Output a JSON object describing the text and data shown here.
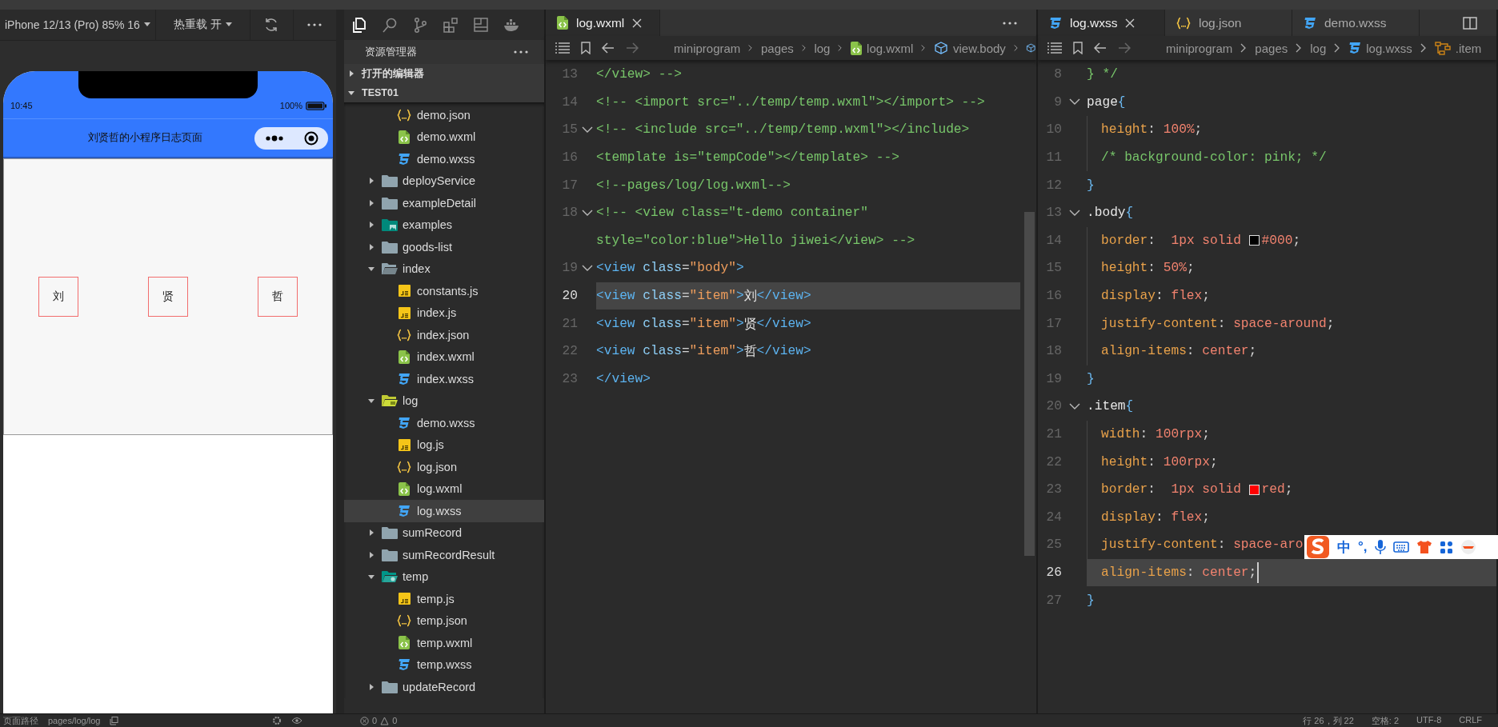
{
  "simulator": {
    "device": "iPhone 12/13 (Pro) 85% 16",
    "hot_reload": "热重载 开",
    "time": "10:45",
    "battery": "100%",
    "nav_title": "刘贤哲的小程序日志页面",
    "items": [
      "刘",
      "贤",
      "哲"
    ]
  },
  "activity_bar": [
    {
      "kind": "files",
      "selected": true
    },
    {
      "kind": "search",
      "selected": false
    },
    {
      "kind": "branch",
      "selected": false
    },
    {
      "kind": "extensions",
      "selected": false
    },
    {
      "kind": "layout",
      "selected": false
    },
    {
      "kind": "whale",
      "selected": false
    }
  ],
  "explorer": {
    "title": "资源管理器",
    "sections": [
      {
        "label": "打开的编辑器",
        "expanded": false
      },
      {
        "label": "TEST01",
        "expanded": true
      }
    ],
    "tree": [
      {
        "children": [
          {
            "label": "demo.json",
            "kind": "json",
            "selected": false
          },
          {
            "label": "demo.wxml",
            "kind": "wxml",
            "selected": false
          },
          {
            "label": "demo.wxss",
            "kind": "wxss",
            "selected": false
          }
        ]
      },
      {
        "label": "deployService",
        "kind": "folder",
        "expanded": false
      },
      {
        "label": "exampleDetail",
        "kind": "folder",
        "expanded": false
      },
      {
        "label": "examples",
        "kind": "folder-images",
        "expanded": false
      },
      {
        "label": "goods-list",
        "kind": "folder",
        "expanded": false
      },
      {
        "label": "index",
        "kind": "folder",
        "expanded": true,
        "children": [
          {
            "label": "constants.js",
            "kind": "js",
            "selected": false
          },
          {
            "label": "index.js",
            "kind": "js",
            "selected": false
          },
          {
            "label": "index.json",
            "kind": "json",
            "selected": false
          },
          {
            "label": "index.wxml",
            "kind": "wxml",
            "selected": false
          },
          {
            "label": "index.wxss",
            "kind": "wxss",
            "selected": false
          }
        ]
      },
      {
        "label": "log",
        "kind": "folder-log",
        "expanded": true,
        "children": [
          {
            "label": "demo.wxss",
            "kind": "wxss",
            "selected": false
          },
          {
            "label": "log.js",
            "kind": "js",
            "selected": false
          },
          {
            "label": "log.json",
            "kind": "json",
            "selected": false
          },
          {
            "label": "log.wxml",
            "kind": "wxml",
            "selected": false
          },
          {
            "label": "log.wxss",
            "kind": "wxss",
            "selected": true
          }
        ]
      },
      {
        "label": "sumRecord",
        "kind": "folder",
        "expanded": false
      },
      {
        "label": "sumRecordResult",
        "kind": "folder",
        "expanded": false
      },
      {
        "label": "temp",
        "kind": "folder-temp",
        "expanded": true,
        "children": [
          {
            "label": "temp.js",
            "kind": "js",
            "selected": false
          },
          {
            "label": "temp.json",
            "kind": "json",
            "selected": false
          },
          {
            "label": "temp.wxml",
            "kind": "wxml",
            "selected": false
          },
          {
            "label": "temp.wxss",
            "kind": "wxss",
            "selected": false
          }
        ]
      },
      {
        "label": "updateRecord",
        "kind": "folder",
        "expanded": false
      }
    ]
  },
  "editors": [
    {
      "tabs": [
        {
          "label": "log.wxml",
          "kind": "wxml",
          "selected": true
        }
      ],
      "breadcrumb": [
        {
          "label": "miniprogram",
          "kind": "folder"
        },
        {
          "label": "pages",
          "kind": "folder"
        },
        {
          "label": "log",
          "kind": "folder"
        },
        {
          "label": "log.wxml",
          "kind": "wxml"
        },
        {
          "label": "view.body",
          "kind": "node"
        },
        {
          "kind": "node"
        }
      ],
      "lines": [
        {
          "number": "13",
          "foldable": false,
          "current": false,
          "indented": false,
          "segments": [
            {
              "text": "</view> -->",
              "kind": "comment"
            }
          ]
        },
        {
          "number": "14",
          "foldable": false,
          "current": false,
          "indented": false,
          "segments": [
            {
              "text": "<!-- <import src=\"../temp/temp.wxml\"></import> -->",
              "kind": "comment"
            }
          ]
        },
        {
          "number": "15",
          "foldable": true,
          "current": false,
          "indented": false,
          "segments": [
            {
              "text": "<!-- <include src=\"../temp/temp.wxml\"></include>",
              "kind": "comment"
            }
          ]
        },
        {
          "number": "16",
          "foldable": false,
          "current": false,
          "indented": false,
          "segments": [
            {
              "text": "<template is=\"tempCode\"></template> -->",
              "kind": "comment"
            }
          ]
        },
        {
          "number": "17",
          "foldable": false,
          "current": false,
          "indented": false,
          "segments": [
            {
              "text": "<!--pages/log/log.wxml-->",
              "kind": "comment"
            }
          ]
        },
        {
          "number": "18",
          "foldable": true,
          "current": false,
          "indented": false,
          "segments": [
            {
              "text": "<!-- <view class=\"t-demo container\"",
              "kind": "comment"
            }
          ]
        },
        {
          "foldable": false,
          "current": false,
          "indented": false,
          "segments": [
            {
              "text": "style=\"color:blue\">Hello jiwei</view> -->",
              "kind": "comment"
            }
          ]
        },
        {
          "number": "19",
          "foldable": true,
          "current": false,
          "indented": false,
          "segments": [
            {
              "text": "<view",
              "kind": "tag"
            },
            {
              "text": " class",
              "kind": "attr"
            },
            {
              "text": "=",
              "kind": "punct"
            },
            {
              "text": "\"body\"",
              "kind": "string"
            },
            {
              "text": ">",
              "kind": "tag"
            }
          ]
        },
        {
          "number": "20",
          "foldable": false,
          "current": true,
          "indented": false,
          "segments": [
            {
              "text": "<view",
              "kind": "tag"
            },
            {
              "text": " class",
              "kind": "attr"
            },
            {
              "text": "=",
              "kind": "punct"
            },
            {
              "text": "\"item\"",
              "kind": "string"
            },
            {
              "text": ">",
              "kind": "tag"
            },
            {
              "text": "刘",
              "kind": "text"
            },
            {
              "text": "</view>",
              "kind": "tag"
            }
          ]
        },
        {
          "number": "21",
          "foldable": false,
          "current": false,
          "indented": false,
          "segments": [
            {
              "text": "<view",
              "kind": "tag"
            },
            {
              "text": " class",
              "kind": "attr"
            },
            {
              "text": "=",
              "kind": "punct"
            },
            {
              "text": "\"item\"",
              "kind": "string"
            },
            {
              "text": ">",
              "kind": "tag"
            },
            {
              "text": "贤",
              "kind": "text"
            },
            {
              "text": "</view>",
              "kind": "tag"
            }
          ]
        },
        {
          "number": "22",
          "foldable": false,
          "current": false,
          "indented": false,
          "segments": [
            {
              "text": "<view",
              "kind": "tag"
            },
            {
              "text": " class",
              "kind": "attr"
            },
            {
              "text": "=",
              "kind": "punct"
            },
            {
              "text": "\"item\"",
              "kind": "string"
            },
            {
              "text": ">",
              "kind": "tag"
            },
            {
              "text": "哲",
              "kind": "text"
            },
            {
              "text": "</view>",
              "kind": "tag"
            }
          ]
        },
        {
          "number": "23",
          "foldable": false,
          "current": false,
          "indented": false,
          "segments": [
            {
              "text": "</view>",
              "kind": "tag"
            }
          ]
        }
      ]
    },
    {
      "tabs": [
        {
          "label": "log.wxss",
          "kind": "wxss",
          "selected": true
        },
        {
          "label": "log.json",
          "kind": "json",
          "selected": false
        },
        {
          "label": "demo.wxss",
          "kind": "wxss",
          "selected": false
        }
      ],
      "breadcrumb": [
        {
          "label": "miniprogram",
          "kind": "folder"
        },
        {
          "label": "pages",
          "kind": "folder"
        },
        {
          "label": "log",
          "kind": "folder"
        },
        {
          "label": "log.wxss",
          "kind": "wxss"
        },
        {
          "label": ".item",
          "kind": "rule"
        }
      ],
      "lines": [
        {
          "number": "8",
          "foldable": false,
          "current": false,
          "indented": false,
          "segments": [
            {
              "text": "} */",
              "kind": "comment"
            }
          ]
        },
        {
          "number": "9",
          "foldable": true,
          "current": false,
          "indented": false,
          "segments": [
            {
              "text": "page",
              "kind": "selector"
            },
            {
              "text": "{",
              "kind": "brace"
            }
          ]
        },
        {
          "number": "10",
          "foldable": false,
          "current": false,
          "indented": true,
          "segments": [
            {
              "text": "height",
              "kind": "prop"
            },
            {
              "text": ": ",
              "kind": "punct"
            },
            {
              "text": "100%",
              "kind": "value"
            },
            {
              "text": ";",
              "kind": "punct"
            }
          ]
        },
        {
          "number": "11",
          "foldable": false,
          "current": false,
          "indented": true,
          "segments": [
            {
              "text": "/* background-color: pink; */",
              "kind": "comment"
            }
          ]
        },
        {
          "number": "12",
          "foldable": false,
          "current": false,
          "indented": false,
          "segments": [
            {
              "text": "}",
              "kind": "brace"
            }
          ]
        },
        {
          "number": "13",
          "foldable": true,
          "current": false,
          "indented": false,
          "segments": [
            {
              "text": ".body",
              "kind": "selector"
            },
            {
              "text": "{",
              "kind": "brace"
            }
          ]
        },
        {
          "number": "14",
          "foldable": false,
          "current": false,
          "indented": true,
          "segments": [
            {
              "text": "border",
              "kind": "prop"
            },
            {
              "text": ":  ",
              "kind": "punct"
            },
            {
              "text": "1px solid ",
              "kind": "value"
            },
            {
              "kind": "swatch",
              "color": "#000000"
            },
            {
              "text": "#000",
              "kind": "value"
            },
            {
              "text": ";",
              "kind": "punct"
            }
          ]
        },
        {
          "number": "15",
          "foldable": false,
          "current": false,
          "indented": true,
          "segments": [
            {
              "text": "height",
              "kind": "prop"
            },
            {
              "text": ": ",
              "kind": "punct"
            },
            {
              "text": "50%",
              "kind": "value"
            },
            {
              "text": ";",
              "kind": "punct"
            }
          ]
        },
        {
          "number": "16",
          "foldable": false,
          "current": false,
          "indented": true,
          "segments": [
            {
              "text": "display",
              "kind": "prop"
            },
            {
              "text": ": ",
              "kind": "punct"
            },
            {
              "text": "flex",
              "kind": "value"
            },
            {
              "text": ";",
              "kind": "punct"
            }
          ]
        },
        {
          "number": "17",
          "foldable": false,
          "current": false,
          "indented": true,
          "segments": [
            {
              "text": "justify-content",
              "kind": "prop"
            },
            {
              "text": ": ",
              "kind": "punct"
            },
            {
              "text": "space-around",
              "kind": "value"
            },
            {
              "text": ";",
              "kind": "punct"
            }
          ]
        },
        {
          "number": "18",
          "foldable": false,
          "current": false,
          "indented": true,
          "segments": [
            {
              "text": "align-items",
              "kind": "prop"
            },
            {
              "text": ": ",
              "kind": "punct"
            },
            {
              "text": "center",
              "kind": "value"
            },
            {
              "text": ";",
              "kind": "punct"
            }
          ]
        },
        {
          "number": "19",
          "foldable": false,
          "current": false,
          "indented": false,
          "segments": [
            {
              "text": "}",
              "kind": "brace"
            }
          ]
        },
        {
          "number": "20",
          "foldable": true,
          "current": false,
          "indented": false,
          "segments": [
            {
              "text": ".item",
              "kind": "selector"
            },
            {
              "text": "{",
              "kind": "brace"
            }
          ]
        },
        {
          "number": "21",
          "foldable": false,
          "current": false,
          "indented": true,
          "segments": [
            {
              "text": "width",
              "kind": "prop"
            },
            {
              "text": ": ",
              "kind": "punct"
            },
            {
              "text": "100rpx",
              "kind": "value"
            },
            {
              "text": ";",
              "kind": "punct"
            }
          ]
        },
        {
          "number": "22",
          "foldable": false,
          "current": false,
          "indented": true,
          "segments": [
            {
              "text": "height",
              "kind": "prop"
            },
            {
              "text": ": ",
              "kind": "punct"
            },
            {
              "text": "100rpx",
              "kind": "value"
            },
            {
              "text": ";",
              "kind": "punct"
            }
          ]
        },
        {
          "number": "23",
          "foldable": false,
          "current": false,
          "indented": true,
          "segments": [
            {
              "text": "border",
              "kind": "prop"
            },
            {
              "text": ":  ",
              "kind": "punct"
            },
            {
              "text": "1px solid ",
              "kind": "value"
            },
            {
              "kind": "swatch",
              "color": "#ff0000"
            },
            {
              "text": "red",
              "kind": "value"
            },
            {
              "text": ";",
              "kind": "punct"
            }
          ]
        },
        {
          "number": "24",
          "foldable": false,
          "current": false,
          "indented": true,
          "segments": [
            {
              "text": "display",
              "kind": "prop"
            },
            {
              "text": ": ",
              "kind": "punct"
            },
            {
              "text": "flex",
              "kind": "value"
            },
            {
              "text": ";",
              "kind": "punct"
            }
          ]
        },
        {
          "number": "25",
          "foldable": false,
          "current": false,
          "indented": true,
          "segments": [
            {
              "text": "justify-content",
              "kind": "prop"
            },
            {
              "text": ": ",
              "kind": "punct"
            },
            {
              "text": "space-aro",
              "kind": "value"
            }
          ]
        },
        {
          "number": "26",
          "foldable": false,
          "current": true,
          "indented": true,
          "segments": [
            {
              "text": "align-items",
              "kind": "prop"
            },
            {
              "text": ": ",
              "kind": "punct"
            },
            {
              "text": "center",
              "kind": "value"
            },
            {
              "text": ";",
              "kind": "punct"
            }
          ]
        },
        {
          "number": "27",
          "foldable": false,
          "current": false,
          "indented": false,
          "segments": [
            {
              "text": "}",
              "kind": "brace"
            }
          ]
        }
      ]
    }
  ],
  "ime_toolbar": {
    "mode": "中",
    "punctuation": "°,"
  },
  "status_bar": {
    "page_path_label": "页面路径",
    "page_path": "pages/log/log",
    "errors": "0",
    "warnings": "0",
    "info": [
      "行 26，列 22",
      "空格: 2",
      "UTF-8",
      "CRLF"
    ]
  }
}
